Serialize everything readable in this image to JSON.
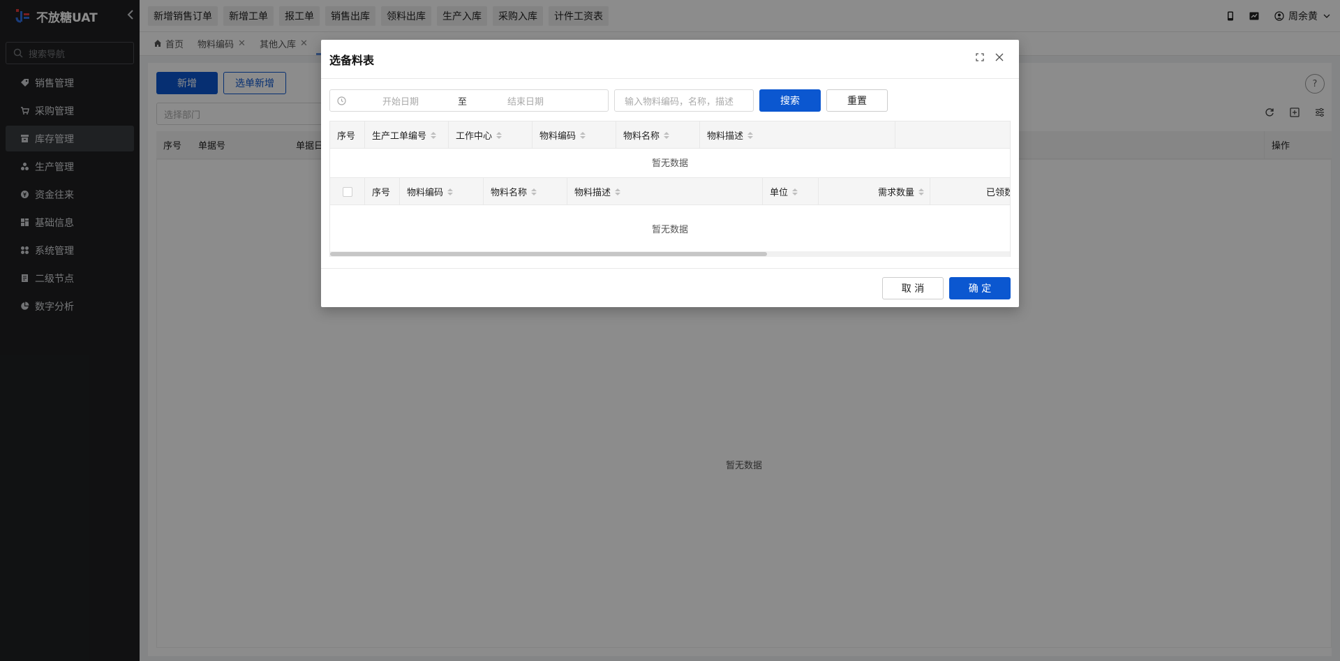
{
  "app": {
    "title": "不放糖UAT",
    "collapse_icon": "chevron-left-icon"
  },
  "sidebar": {
    "search_placeholder": "搜索导航",
    "items": [
      {
        "label": "销售管理",
        "icon": "tag-icon"
      },
      {
        "label": "采购管理",
        "icon": "cart-icon"
      },
      {
        "label": "库存管理",
        "icon": "inventory-icon",
        "active": true
      },
      {
        "label": "生产管理",
        "icon": "production-icon"
      },
      {
        "label": "资金往来",
        "icon": "money-icon"
      },
      {
        "label": "基础信息",
        "icon": "grid-icon"
      },
      {
        "label": "系统管理",
        "icon": "apps-icon"
      },
      {
        "label": "二级节点",
        "icon": "document-icon"
      },
      {
        "label": "数字分析",
        "icon": "pie-chart-icon"
      }
    ]
  },
  "topbar": {
    "quick_buttons": [
      "新增销售订单",
      "新增工单",
      "报工单",
      "销售出库",
      "领料出库",
      "生产入库",
      "采购入库",
      "计件工资表"
    ],
    "user_name": "周余黄"
  },
  "tabs": [
    {
      "label": "首页",
      "closable": false,
      "icon": "home-icon"
    },
    {
      "label": "物料编码",
      "closable": true
    },
    {
      "label": "其他入库",
      "closable": true
    }
  ],
  "content": {
    "new_button": "新增",
    "select_new_button": "选单新增",
    "dept_placeholder": "选择部门",
    "table_headers": [
      "序号",
      "单据号",
      "单据日"
    ],
    "operation_header": "操作",
    "empty_text": "暂无数据"
  },
  "modal": {
    "title": "选备料表",
    "start_date_placeholder": "开始日期",
    "range_separator": "至",
    "end_date_placeholder": "结束日期",
    "keyword_placeholder": "输入物料编码，名称，描述",
    "search_button": "搜索",
    "reset_button": "重置",
    "table1": {
      "columns": [
        "序号",
        "生产工单编号",
        "工作中心",
        "物料编码",
        "物料名称",
        "物料描述"
      ],
      "empty_text": "暂无数据"
    },
    "table2": {
      "columns": [
        "序号",
        "物料编码",
        "物料名称",
        "物料描述",
        "单位",
        "需求数量",
        "已领数"
      ],
      "empty_text": "暂无数据"
    },
    "cancel_button": "取 消",
    "ok_button": "确 定"
  },
  "colors": {
    "primary": "#0b57d0",
    "sidebar_bg": "#1f2022",
    "mask": "rgba(0,0,0,0.45)"
  }
}
